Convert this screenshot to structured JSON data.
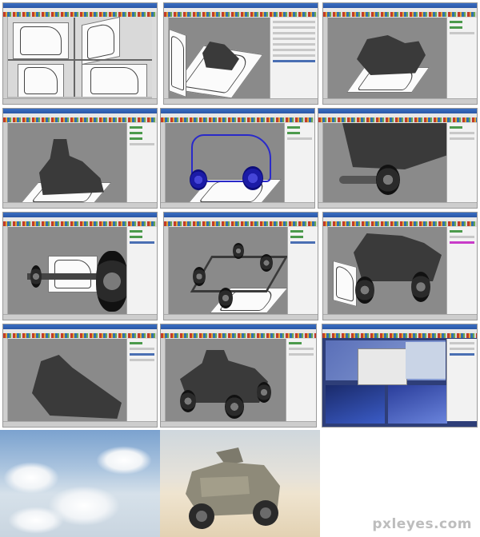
{
  "watermark": "pxleyes.com",
  "colors": {
    "background": "#ffffff",
    "viewport": "#8a8a8a",
    "titlebar": "#2b57a5",
    "wireframe": "#2a2ac9"
  },
  "panels": [
    {
      "name": "step-1-blueprints"
    },
    {
      "name": "step-2-hull-blockout"
    },
    {
      "name": "step-3-hull-shape"
    },
    {
      "name": "step-4-turret"
    },
    {
      "name": "step-5-wireframe"
    },
    {
      "name": "step-6-wheel-closeup"
    },
    {
      "name": "step-7-axle-closeup"
    },
    {
      "name": "step-8-chassis"
    },
    {
      "name": "step-9-assembled"
    },
    {
      "name": "step-10-hull-only"
    },
    {
      "name": "step-11-full-model"
    },
    {
      "name": "step-12-render-setup"
    }
  ],
  "renders": [
    {
      "name": "sky-backdrop"
    },
    {
      "name": "final-render"
    }
  ]
}
